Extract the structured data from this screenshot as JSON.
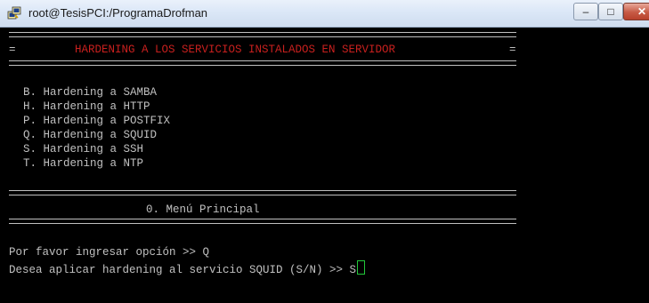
{
  "window": {
    "title": "root@TesisPCI:/ProgramaDrofman",
    "app_icon": "putty-icon",
    "controls": {
      "minimize": "minimize-icon",
      "maximize": "maximize-icon",
      "close": "close-icon"
    }
  },
  "terminal": {
    "banner_edge": "=",
    "header_title": "HARDENING A LOS SERVICIOS INSTALADOS EN SERVIDOR",
    "menu_items": [
      "B. Hardening a SAMBA",
      "H. Hardening a HTTP",
      "P. Hardening a POSTFIX",
      "Q. Hardening a SQUID",
      "S. Hardening a SSH",
      "T. Hardening a NTP"
    ],
    "main_menu": "0. Menú Principal",
    "prompt_line": "Por favor ingresar opción >> Q",
    "confirm_prompt": "Desea aplicar hardening al servicio SQUID (S/N) >> S",
    "colors": {
      "background": "#000000",
      "text": "#c0c0c0",
      "header": "#c8201e",
      "cursor": "#22c83a"
    }
  }
}
